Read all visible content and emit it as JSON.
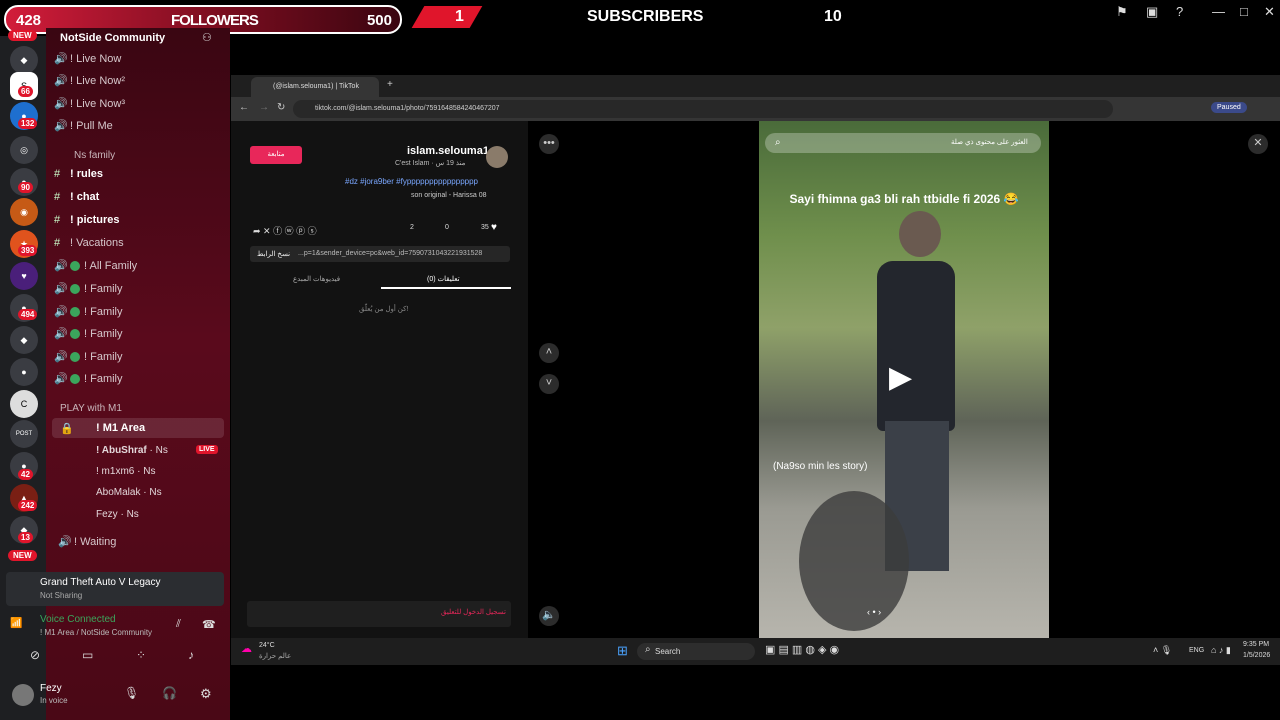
{
  "overlay": {
    "followers_count": "428",
    "followers_label": "FOLLOWERS",
    "followers_goal": "500",
    "red_number": "1",
    "subscribers_label": "SUBSCRIBERS",
    "subscribers_count": "10"
  },
  "discord": {
    "server_badges": [
      "66",
      "132",
      "90",
      "393",
      "494",
      "242",
      "13",
      "42"
    ],
    "new_label": "NEW",
    "server_name": "NotSide Community",
    "channels_top": [
      {
        "label": "! Live Now"
      },
      {
        "label": "! Live Now²"
      },
      {
        "label": "! Live Now³"
      },
      {
        "label": "! Pull Me"
      }
    ],
    "category_ns": "Ns family",
    "text_channels": [
      {
        "label": "! rules"
      },
      {
        "label": "! chat"
      },
      {
        "label": "! pictures"
      },
      {
        "label": "! Vacations"
      }
    ],
    "voice_channels": [
      {
        "label": "! All Family"
      },
      {
        "label": "! Family"
      },
      {
        "label": "! Family"
      },
      {
        "label": "! Family"
      },
      {
        "label": "! Family"
      },
      {
        "label": "! Family"
      }
    ],
    "category_play": "PLAY with M1",
    "m1_area": "! M1 Area",
    "users": [
      {
        "name": "! AbuShraf",
        "tag": "Ns"
      },
      {
        "name": "! m1xm6",
        "tag": "Ns"
      },
      {
        "name": "AboMalak",
        "tag": "Ns"
      },
      {
        "name": "Fezy",
        "tag": "Ns"
      }
    ],
    "live_label": "LIVE",
    "waiting": "! Waiting",
    "activity_title": "Grand Theft Auto V Legacy",
    "activity_sub": "Not Sharing",
    "voice_connected": "Voice Connected",
    "voice_path": "! M1 Area / NotSide Community",
    "me_name": "Fezy",
    "me_status": "In voice"
  },
  "browser": {
    "tab_title": "(@islam.selouma1) | TikTok",
    "url": "tiktok.com/@islam.selouma1/photo/7591648584240467207",
    "paused": "Paused",
    "follow_btn": "متابعة",
    "username": "islam.selouma1",
    "meta": "C'est Islam · منذ 19 س",
    "hashtags": "#dz #jora9ber #fypppppppppppppppp",
    "sound": "son original - Harissa 08",
    "likes": "35",
    "comments": "0",
    "saves": "2",
    "copy_link": "نسخ الرابط",
    "link_text": "...p=1&sender_device=pc&web_id=7590731043221931528",
    "tab_comments": "تعليقات (0)",
    "tab_creator": "فيديوهات المبدع",
    "no_comments": "كن أول من يُعلّق!",
    "login_to_comment": "تسجيل الدخول للتعليق",
    "search_hint": "العثور على محتوى ذي صلة",
    "caption_top": "Sayi fhimna ga3 bli rah ttbidle fi 2026 😂",
    "caption_mid": "(Na9so min les story)"
  },
  "taskbar": {
    "weather": "24°C",
    "weather_sub": "عالم حرارة",
    "search": "Search",
    "lang": "ENG",
    "time": "9:35 PM",
    "date": "1/5/2026"
  }
}
